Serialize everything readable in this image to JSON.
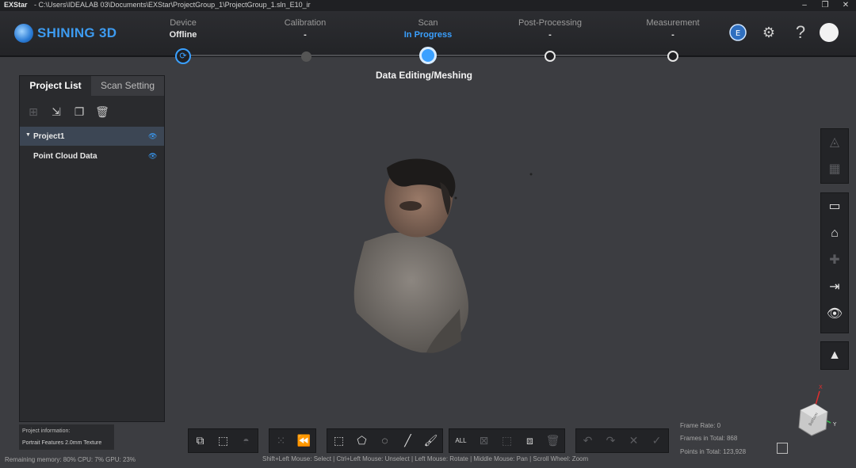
{
  "titlebar": {
    "app_name": "EXStar",
    "path": "-  C:\\Users\\IDEALAB 03\\Documents\\EXStar\\ProjectGroup_1\\ProjectGroup_1.sln_E10_ir"
  },
  "brand": {
    "logo_text": "SHINING 3D",
    "accent": "#3aa0ff"
  },
  "steps": [
    {
      "label": "Device",
      "value": "Offline"
    },
    {
      "label": "Calibration",
      "value": "-"
    },
    {
      "label": "Scan",
      "value": "In Progress"
    },
    {
      "label": "Post-Processing",
      "value": "-"
    },
    {
      "label": "Measurement",
      "value": "-"
    }
  ],
  "stage_label": "Data Editing/Meshing",
  "panel": {
    "tabs": [
      "Project List",
      "Scan Setting"
    ],
    "tools": [
      "add-icon",
      "import-icon",
      "duplicate-icon",
      "delete-icon"
    ],
    "tree": [
      {
        "label": "Project1",
        "expanded": true
      },
      {
        "label": "Point Cloud Data"
      }
    ]
  },
  "project_info": {
    "title": "Project information:",
    "values": "Portrait  Features  2.0mm  Texture"
  },
  "status": {
    "memory": "Remaining memory: 80% CPU: 7% GPU: 23%",
    "hint": "Shift+Left Mouse: Select | Ctrl+Left Mouse: Unselect | Left Mouse: Rotate | Middle Mouse: Pan | Scroll Wheel: Zoom",
    "frame_rate": "Frame Rate: 0",
    "frames_total": "Frames in Total: 868",
    "points_total": "Points in Total: 123,928"
  },
  "axes": {
    "x": "X",
    "y": "Y",
    "cube_face": "Bottom"
  }
}
